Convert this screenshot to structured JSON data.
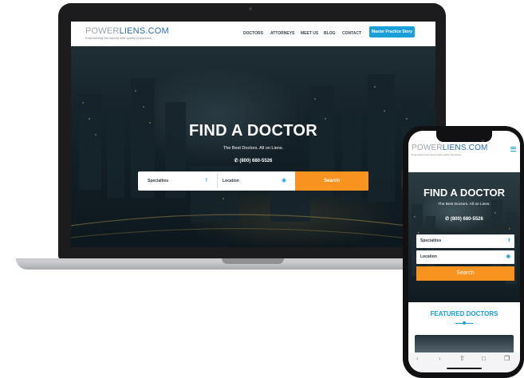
{
  "site": {
    "logo_part1": "POWER",
    "logo_part2": "LIENS.COM",
    "tagline": "Empowering the injured with quality physicians.",
    "nav": [
      "DOCTORS",
      "ATTORNEYS",
      "MEET US",
      "BLOG",
      "CONTACT"
    ],
    "cta": "Master Practice Story",
    "hero_title": "FIND A DOCTOR",
    "hero_subtitle": "The Best Doctors. All on Liens.",
    "phone": "(800) 680-5526",
    "search": {
      "specialties_label": "Specialties",
      "location_label": "Location",
      "button": "Search"
    },
    "featured_heading": "FEATURED DOCTORS"
  },
  "icons": {
    "phone": "phone-icon",
    "specialties": "stethoscope-icon",
    "location": "map-pin-icon",
    "menu": "hamburger-icon",
    "toolbar": [
      "back-icon",
      "forward-icon",
      "share-icon",
      "bookmarks-icon",
      "tabs-icon"
    ]
  },
  "colors": {
    "accent_blue": "#1a9fd9",
    "accent_orange": "#f7931e",
    "logo_gray": "#9aa3ab",
    "logo_blue": "#2a6fb0"
  }
}
